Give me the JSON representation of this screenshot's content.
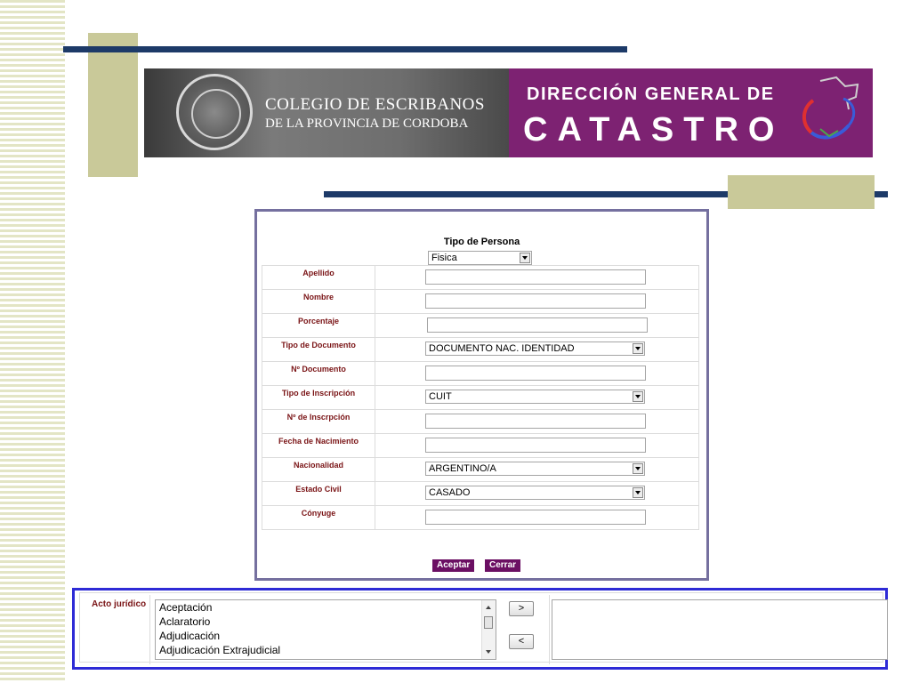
{
  "banner": {
    "colegio_line1": "COLEGIO DE ESCRIBANOS",
    "colegio_line2": "DE LA PROVINCIA DE CORDOBA",
    "dgc_line1": "DIRECCIÓN GENERAL DE",
    "dgc_line2": "CATASTRO"
  },
  "form": {
    "tipo_persona_label": "Tipo de Persona",
    "tipo_persona_value": "Fisica",
    "fields": {
      "apellido": "Apellido",
      "nombre": "Nombre",
      "porcentaje": "Porcentaje",
      "tipo_documento": "Tipo de Documento",
      "tipo_documento_value": "DOCUMENTO NAC. IDENTIDAD",
      "nro_documento": "Nº Documento",
      "tipo_inscripcion": "Tipo de Inscripción",
      "tipo_inscripcion_value": "CUIT",
      "nro_inscripcion": "Nº de Inscrpción",
      "fecha_nacimiento": "Fecha de Nacimiento",
      "nacionalidad": "Nacionalidad",
      "nacionalidad_value": "ARGENTINO/A",
      "estado_civil": "Estado Civil",
      "estado_civil_value": "CASADO",
      "conyuge": "Cónyuge"
    },
    "aceptar_label": "Aceptar",
    "cerrar_label": "Cerrar"
  },
  "acto": {
    "label": "Acto jurídico",
    "items": [
      "Aceptación",
      "Aclaratorio",
      "Adjudicación",
      "Adjudicación Extrajudicial"
    ],
    "add_label": ">",
    "remove_label": "<"
  },
  "colors": {
    "navy": "#1d3a68",
    "olive": "#c9c999",
    "purple": "#7d2272",
    "button_purple": "#6b0f63",
    "label_red": "#7a1416",
    "panel_border": "#75709f",
    "acto_border": "#2e2bd6"
  }
}
